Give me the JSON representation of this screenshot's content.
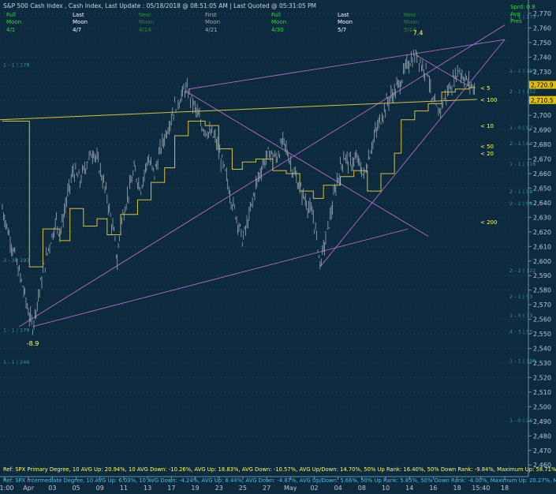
{
  "header": {
    "title": "S&P 500 Cash Index , Cash Index, Last Update :  05/18/2018 @ 08:51:05 AM | Last Quoted @ 05:31:05 PM",
    "moon_cols": [
      {
        "label": "Full",
        "name": "Moon",
        "date": "4/1",
        "color": "#33dd33"
      },
      {
        "label": "Last",
        "name": "Moon",
        "date": "4/7",
        "color": "#ffffff"
      },
      {
        "label": "New",
        "name": "Moon",
        "date": "4/14",
        "color": "#2e8b2e"
      },
      {
        "label": "First",
        "name": "Moon",
        "date": "4/21",
        "color": "#aaaaaa"
      },
      {
        "label": "Full",
        "name": "Moon",
        "date": "4/30",
        "color": "#33dd33"
      },
      {
        "label": "Last",
        "name": "Moon",
        "date": "5/7",
        "color": "#ffffff"
      },
      {
        "label": "New",
        "name": "Moon",
        "date": "5/14",
        "color": "#2e8b2e"
      }
    ],
    "right_box": [
      "Sprd: 0.8",
      "Avg",
      "Pres"
    ]
  },
  "chart_data": {
    "type": "line",
    "ylim": [
      2452,
      2777
    ],
    "y_ticks": [
      2460,
      2470,
      2480,
      2490,
      2500,
      2510,
      2520,
      2530,
      2540,
      2550,
      2560,
      2570,
      2580,
      2590,
      2600,
      2610,
      2620,
      2630,
      2640,
      2650,
      2660,
      2670,
      2680,
      2690,
      2700,
      2710,
      2720,
      2730,
      2740,
      2750,
      2760,
      2770
    ],
    "x_ticks": [
      "11:00",
      "Apr",
      "03",
      "05",
      "09",
      "11",
      "13",
      "17",
      "19",
      "23",
      "25",
      "27",
      "May",
      "02",
      "04",
      "08",
      "10",
      "14",
      "16",
      "18",
      "15:40",
      "18"
    ],
    "price_series": [
      [
        0,
        2636
      ],
      [
        2,
        2618
      ],
      [
        4,
        2600
      ],
      [
        6,
        2583
      ],
      [
        8,
        2562
      ],
      [
        9,
        2555
      ],
      [
        10,
        2568
      ],
      [
        12,
        2592
      ],
      [
        14,
        2612
      ],
      [
        16,
        2628
      ],
      [
        17,
        2618
      ],
      [
        19,
        2642
      ],
      [
        21,
        2662
      ],
      [
        23,
        2655
      ],
      [
        25,
        2668
      ],
      [
        27,
        2676
      ],
      [
        29,
        2662
      ],
      [
        31,
        2644
      ],
      [
        32,
        2630
      ],
      [
        33,
        2618
      ],
      [
        34,
        2600
      ],
      [
        35,
        2625
      ],
      [
        37,
        2644
      ],
      [
        39,
        2662
      ],
      [
        41,
        2650
      ],
      [
        43,
        2670
      ],
      [
        45,
        2660
      ],
      [
        47,
        2678
      ],
      [
        49,
        2692
      ],
      [
        51,
        2706
      ],
      [
        53,
        2713
      ],
      [
        54,
        2718
      ],
      [
        55,
        2716
      ],
      [
        57,
        2705
      ],
      [
        59,
        2693
      ],
      [
        61,
        2688
      ],
      [
        63,
        2684
      ],
      [
        64,
        2675
      ],
      [
        66,
        2660
      ],
      [
        68,
        2640
      ],
      [
        70,
        2625
      ],
      [
        71,
        2614
      ],
      [
        73,
        2630
      ],
      [
        75,
        2652
      ],
      [
        77,
        2666
      ],
      [
        79,
        2675
      ],
      [
        81,
        2670
      ],
      [
        83,
        2682
      ],
      [
        84,
        2677
      ],
      [
        86,
        2662
      ],
      [
        88,
        2650
      ],
      [
        90,
        2640
      ],
      [
        92,
        2630
      ],
      [
        93,
        2616
      ],
      [
        94,
        2598
      ],
      [
        95,
        2608
      ],
      [
        97,
        2630
      ],
      [
        99,
        2655
      ],
      [
        101,
        2672
      ],
      [
        103,
        2667
      ],
      [
        105,
        2670
      ],
      [
        107,
        2658
      ],
      [
        108,
        2668
      ],
      [
        110,
        2685
      ],
      [
        112,
        2698
      ],
      [
        114,
        2710
      ],
      [
        116,
        2716
      ],
      [
        118,
        2724
      ],
      [
        120,
        2736
      ],
      [
        122,
        2740
      ],
      [
        123,
        2742
      ],
      [
        124,
        2734
      ],
      [
        126,
        2730
      ],
      [
        127,
        2710
      ],
      [
        129,
        2702
      ],
      [
        131,
        2712
      ],
      [
        133,
        2722
      ],
      [
        135,
        2732
      ],
      [
        136,
        2728
      ],
      [
        138,
        2722
      ],
      [
        140,
        2718
      ]
    ],
    "yellow_steps": [
      [
        0,
        2696
      ],
      [
        8,
        2596
      ],
      [
        12,
        2622
      ],
      [
        17,
        2614
      ],
      [
        20,
        2636
      ],
      [
        24,
        2624
      ],
      [
        28,
        2629
      ],
      [
        31,
        2618
      ],
      [
        35,
        2632
      ],
      [
        40,
        2642
      ],
      [
        44,
        2654
      ],
      [
        48,
        2664
      ],
      [
        51,
        2686
      ],
      [
        55,
        2696
      ],
      [
        60,
        2693
      ],
      [
        64,
        2677
      ],
      [
        68,
        2663
      ],
      [
        71,
        2668
      ],
      [
        75,
        2670
      ],
      [
        80,
        2662
      ],
      [
        84,
        2660
      ],
      [
        88,
        2648
      ],
      [
        92,
        2643
      ],
      [
        95,
        2652
      ],
      [
        100,
        2658
      ],
      [
        104,
        2662
      ],
      [
        108,
        2648
      ],
      [
        112,
        2660
      ],
      [
        116,
        2674
      ],
      [
        118,
        2697
      ],
      [
        122,
        2703
      ],
      [
        126,
        2708
      ],
      [
        130,
        2716
      ],
      [
        134,
        2718
      ],
      [
        138,
        2719
      ]
    ],
    "ma_labels": [
      {
        "text": "< 5",
        "value": 2719
      },
      {
        "text": "< 100",
        "value": 2711
      },
      {
        "text": "< 10",
        "value": 2693
      },
      {
        "text": "< 50",
        "value": 2679
      },
      {
        "text": "< 20",
        "value": 2674
      },
      {
        "text": "< 200",
        "value": 2627
      }
    ],
    "price_tags": [
      {
        "text": "2,720.9",
        "value": 2720.9,
        "color": "#e0c000"
      },
      {
        "text": "2,710.5",
        "value": 2710.5,
        "color": "#e0c000"
      }
    ],
    "pivot_labels": [
      {
        "text": "7.4",
        "index": 123,
        "value": 2755,
        "color": "#ffff66"
      },
      {
        "text": "-8.9",
        "index": 9,
        "value": 2542,
        "color": "#ffff66"
      }
    ],
    "level_labels": [
      {
        "text": "1 - 1 | 178",
        "side": "left",
        "value": 2735
      },
      {
        "text": "3 - 3 | 197",
        "side": "left",
        "value": 2601
      },
      {
        "text": "1 - 1 | 178",
        "side": "left",
        "value": 2553
      },
      {
        "text": "1 - 1 | 246",
        "side": "left",
        "value": 2531
      },
      {
        "text": "1 - 1 | 195",
        "side": "right",
        "value": 2731
      },
      {
        "text": "2 - 1 | 152",
        "side": "right",
        "value": 2717
      },
      {
        "text": "1 - 0 | 92",
        "side": "right",
        "value": 2692
      },
      {
        "text": "2 - 1 | 84",
        "side": "right",
        "value": 2681
      },
      {
        "text": "1 - 1 | 116",
        "side": "right",
        "value": 2667
      },
      {
        "text": "2 - 1 | 98",
        "side": "right",
        "value": 2648
      },
      {
        "text": "2 - 1 | 98",
        "side": "right",
        "value": 2640
      },
      {
        "text": "2 - 2 | 122",
        "side": "right",
        "value": 2594
      },
      {
        "text": "2 - 1 | 53",
        "side": "right",
        "value": 2576
      },
      {
        "text": "1 - 0 | 33",
        "side": "right",
        "value": 2563
      },
      {
        "text": "4 - 3 | 55",
        "side": "right",
        "value": 2552
      },
      {
        "text": "1 - 1 | 196",
        "side": "right",
        "value": 2532
      },
      {
        "text": "1 - 0 | 26",
        "side": "right",
        "value": 2491
      },
      {
        "text": "1 - 1 | 179",
        "side": "right",
        "value": 2768
      }
    ],
    "footer": [
      "Ref: SPX Primary Degree, 10 AVG Up: 20.94%, 10 AVG Down: -10.26%, AVG Up: 18.83%, AVG Down: -10.57%, AVG Up/Down: 14.70%, 50%  Up Rank: 16.40%, 50% Down Rank: -9.84%, Maximum Up: 58.71%, Maximum",
      "Ref: SPX Intermediate Degree, 10 AVG Up: 6.03%, 10 AVG Down: -4.24%, AVG Up: 6.44%, AVG Down: -4.87%, AVG Up/Down: 5.66%, 50%  Up Rank: 5.85%, 50% Down Rank: -4.00%, Maximum Up: 20.27%, Maximum Do"
    ]
  }
}
